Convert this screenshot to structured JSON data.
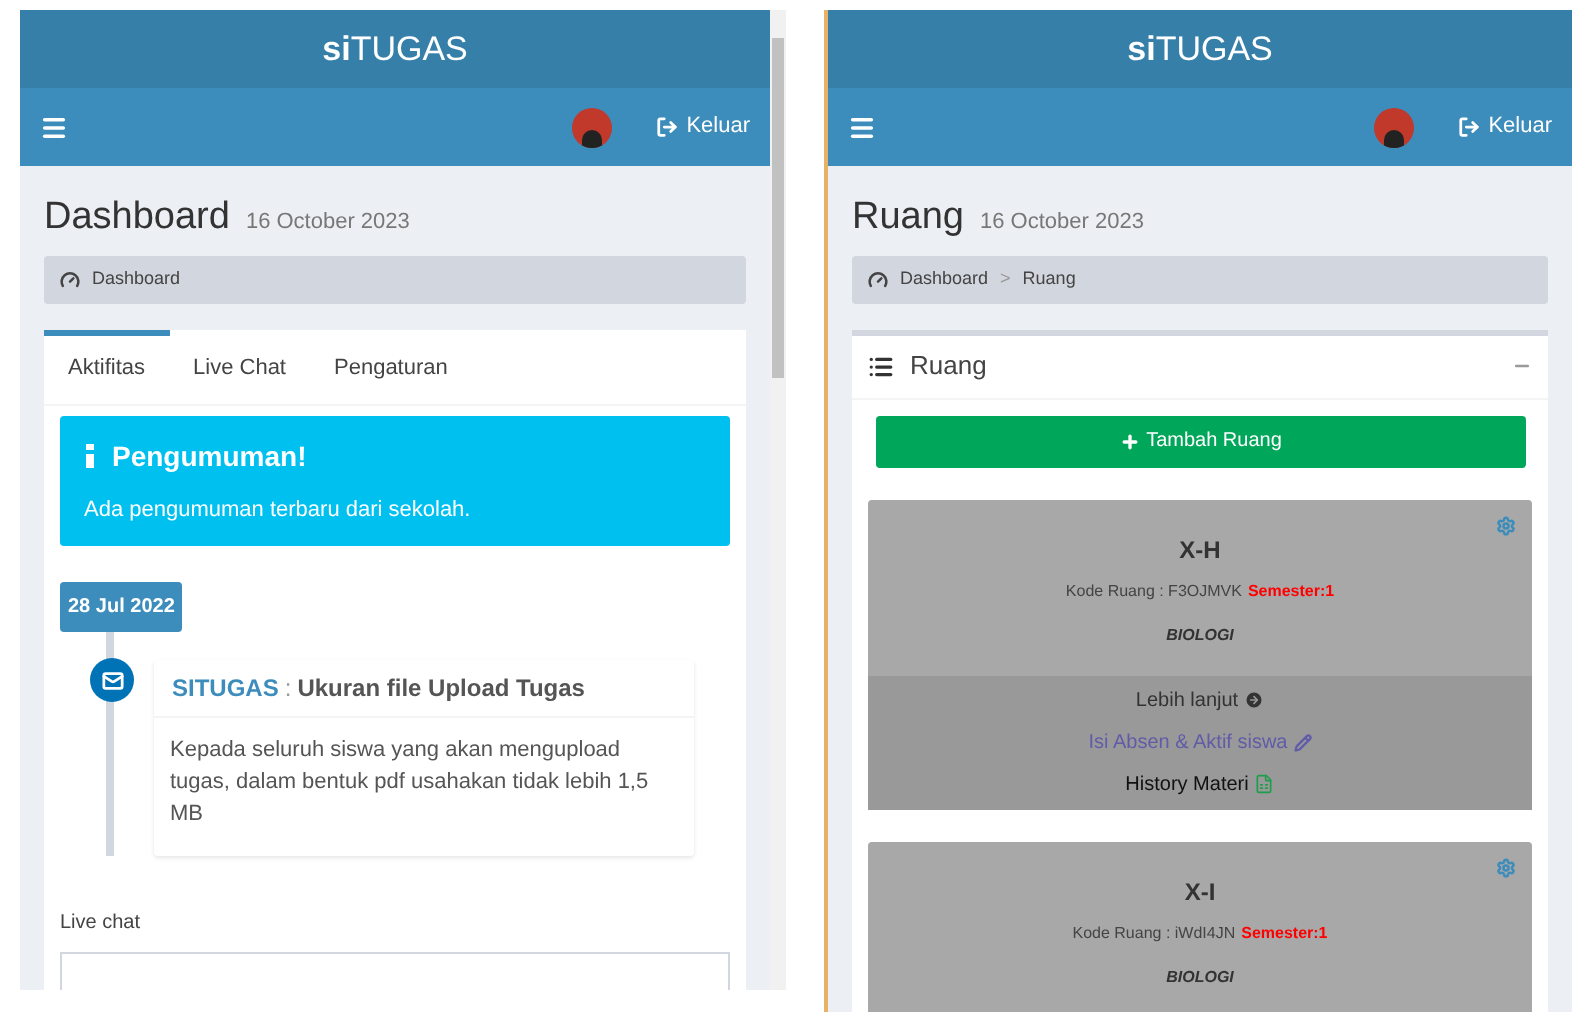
{
  "screens": [
    {
      "kind": "dashboard",
      "brand": "**si**TUGAS",
      "logout": "Keluar",
      "page_title": "Dashboard",
      "page_date": "16 October 2023",
      "breadcrumb": [
        "Dashboard"
      ],
      "tabs": [
        {
          "label": "Aktifitas",
          "selected": true
        },
        {
          "label": "Live Chat",
          "selected": false
        },
        {
          "label": "Pengaturan",
          "selected": false
        }
      ],
      "announcement": {
        "title": "Pengumuman!",
        "text": "Ada pengumuman terbaru dari sekolah."
      },
      "timeline": {
        "date": "28 Jul 2022",
        "source": "SITUGAS",
        "separator": ":",
        "title": "Ukuran file Upload Tugas",
        "body": "Kepada seluruh siswa yang akan mengupload tugas, dalam bentuk pdf usahakan tidak lebih 1,5 MB"
      },
      "chat_label": "Live chat"
    },
    {
      "kind": "ruang",
      "brand": "**si**TUGAS",
      "logout": "Keluar",
      "page_title": "Ruang",
      "page_date": "16 October 2023",
      "breadcrumb": [
        "Dashboard",
        ">",
        "Ruang"
      ],
      "box_title": "Ruang",
      "add_button": "Tambah Ruang",
      "rooms": [
        {
          "name": "X-H",
          "code_label": "Kode Ruang : F3OJMVK",
          "semester": "Semester:1",
          "subject": "BIOLOGI",
          "links": [
            "Lebih lanjut",
            "Isi Absen & Aktif siswa",
            "History Materi"
          ]
        },
        {
          "name": "X-I",
          "code_label": "Kode Ruang : iWdI4JN",
          "semester": "Semester:1",
          "subject": "BIOLOGI"
        }
      ]
    }
  ]
}
